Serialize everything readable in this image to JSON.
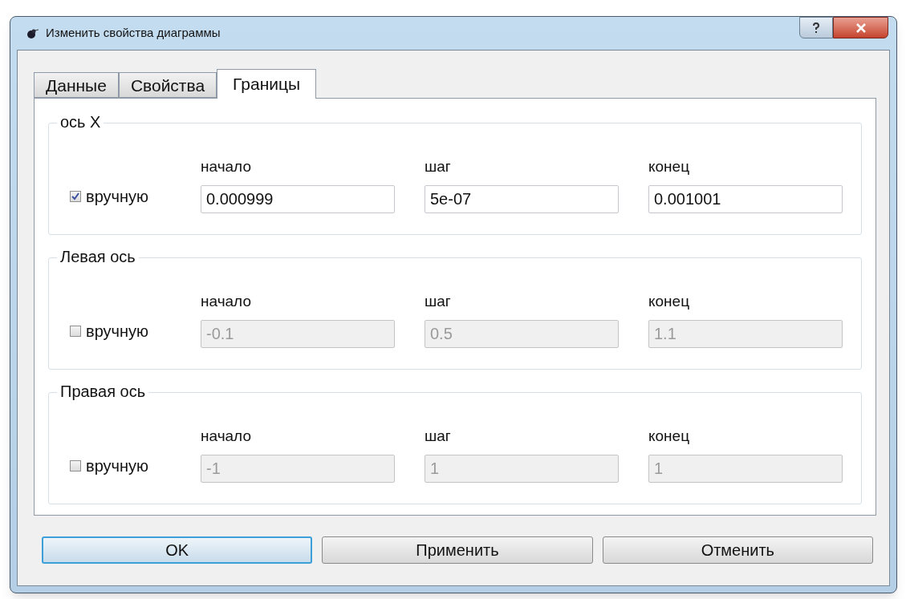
{
  "window": {
    "title": "Изменить свойства диаграммы"
  },
  "tabs": [
    {
      "label": "Данные",
      "selected": false
    },
    {
      "label": "Свойства",
      "selected": false
    },
    {
      "label": "Границы",
      "selected": true
    }
  ],
  "groups": [
    {
      "title": "ось X",
      "checkbox": {
        "label": "вручную",
        "checked": true
      },
      "fields": [
        {
          "label": "начало",
          "value": "0.000999",
          "disabled": false
        },
        {
          "label": "шаг",
          "value": "5e-07",
          "disabled": false
        },
        {
          "label": "конец",
          "value": "0.001001",
          "disabled": false
        }
      ]
    },
    {
      "title": "Левая ось",
      "checkbox": {
        "label": "вручную",
        "checked": false
      },
      "fields": [
        {
          "label": "начало",
          "value": "-0.1",
          "disabled": true
        },
        {
          "label": "шаг",
          "value": "0.5",
          "disabled": true
        },
        {
          "label": "конец",
          "value": "1.1",
          "disabled": true
        }
      ]
    },
    {
      "title": "Правая ось",
      "checkbox": {
        "label": "вручную",
        "checked": false
      },
      "fields": [
        {
          "label": "начало",
          "value": "-1",
          "disabled": true
        },
        {
          "label": "шаг",
          "value": "1",
          "disabled": true
        },
        {
          "label": "конец",
          "value": "1",
          "disabled": true
        }
      ]
    }
  ],
  "buttons": [
    {
      "label": "OK",
      "default": true
    },
    {
      "label": "Применить",
      "default": false
    },
    {
      "label": "Отменить",
      "default": false
    }
  ]
}
